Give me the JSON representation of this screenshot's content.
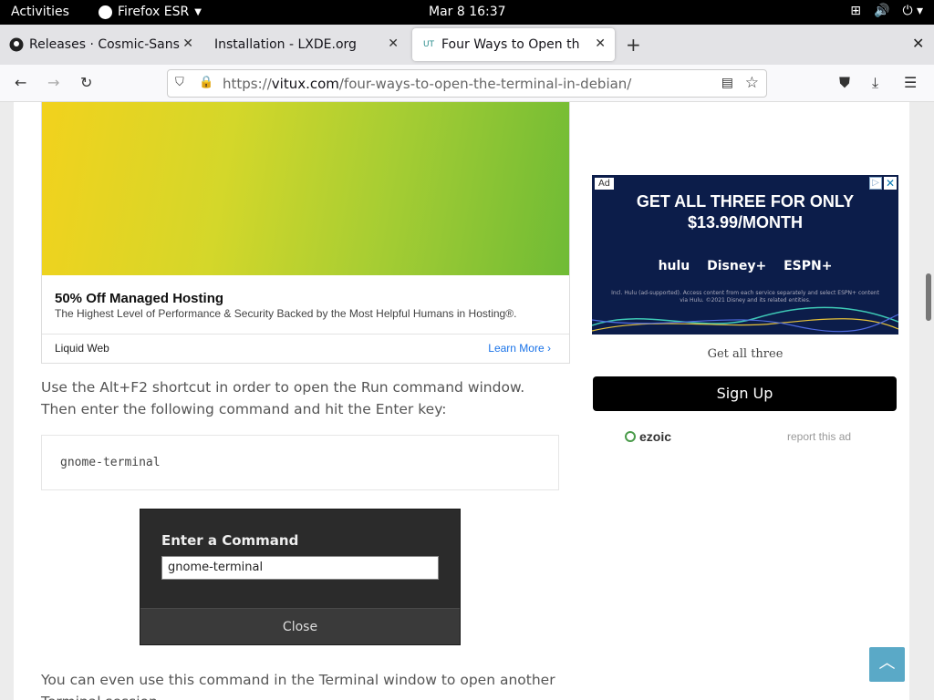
{
  "topbar": {
    "activities": "Activities",
    "app_name": "Firefox ESR",
    "clock": "Mar 8  16:37"
  },
  "tabs": [
    {
      "title": "Releases · Cosmic-Sans/c",
      "favicon": "github-icon",
      "active": false
    },
    {
      "title": "Installation - LXDE.org",
      "favicon": "",
      "active": false
    },
    {
      "title": "Four Ways to Open the Te",
      "favicon": "UT",
      "active": true
    }
  ],
  "navbar": {
    "url_prefix": "https://",
    "url_host": "vitux.com",
    "url_path": "/four-ways-to-open-the-terminal-in-debian/"
  },
  "left_ad": {
    "title": "50% Off Managed Hosting",
    "subtitle": "The Highest Level of Performance & Security Backed by the Most Helpful Humans in Hosting®.",
    "brand": "Liquid Web",
    "cta": "Learn More"
  },
  "content": {
    "para1": "Use the Alt+F2 shortcut in order to open the Run command window. Then enter the following command and hit the Enter key:",
    "code": "gnome-terminal",
    "para2": "You can even use this command in the Terminal window to open another Terminal session."
  },
  "run_dialog": {
    "title": "Enter a Command",
    "input_value": "gnome-terminal",
    "close_label": "Close"
  },
  "right_ad": {
    "tag": "Ad",
    "headline": "GET ALL THREE FOR ONLY $13.99/MONTH",
    "logos": "hulu Disney+ ESPN+",
    "fine_print": "Incl. Hulu (ad-supported). Access content from each service separately and select ESPN+ content via Hulu. ©2021 Disney and its related entities.",
    "caption": "Get all three",
    "cta": "Sign Up"
  },
  "ezoic": {
    "brand": "ezoic",
    "report": "report this ad"
  },
  "colors": {
    "signup_bg": "#000000",
    "backtop_bg": "#5aa9c7",
    "disney_bg": "#0c1d4a"
  }
}
